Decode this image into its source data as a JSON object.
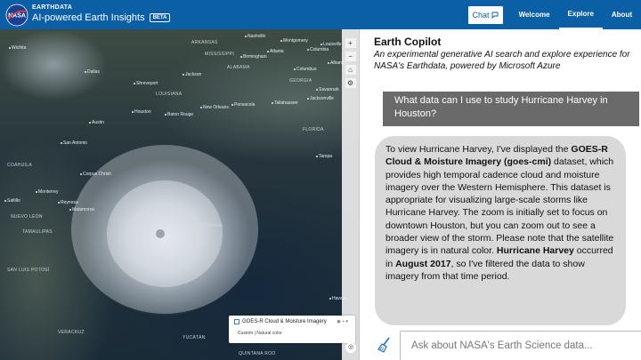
{
  "header": {
    "brand_top": "EARTHDATA",
    "brand_main": "AI-powered Earth Insights",
    "badge": "BETA",
    "logo_icon": "nasa-logo-icon",
    "chat_label": "Chat",
    "nav": [
      {
        "label": "Welcome"
      },
      {
        "label": "Explore"
      },
      {
        "label": "About"
      }
    ]
  },
  "map": {
    "cities": [
      "Louisville",
      "Wichita",
      "Montgomery",
      "Albany",
      "Nashville",
      "Birmingham",
      "Atlanta",
      "Columbus",
      "Columbia",
      "Jackson",
      "Tallahassee",
      "Savannah",
      "Dallas",
      "Shreveport",
      "Baton Rouge",
      "Jacksonville",
      "Austin",
      "New Orleans",
      "Tampa",
      "Houston",
      "San Antonio",
      "Pensacola",
      "Monterrey",
      "Corpus Christi",
      "Saltillo",
      "Reynosa",
      "Matamoros",
      "Havana"
    ],
    "regions": [
      "ARKANSAS",
      "MISSISSIPPI",
      "ALABAMA",
      "GEORGIA",
      "LOUISIANA",
      "FLORIDA",
      "COAHUILA",
      "NUEVO LEÓN",
      "TAMAULIPAS",
      "SAN LUIS POTOSÍ",
      "VERACRUZ",
      "YUCATÁN",
      "QUINTANA ROO"
    ],
    "gulf_label": "Gulf of Mexico",
    "layer": {
      "title": "GOES-R Cloud & Moisture Imagery",
      "subtitle": "Custom | Natural color"
    },
    "tools": [
      "+",
      "−",
      "⌂",
      "⚙"
    ]
  },
  "panel": {
    "title": "Earth Copilot",
    "description": "An experimental generative AI search and explore experience for NASA's Earthdata, powered by Microsoft Azure",
    "user_message": "What data can I use to study Hurricane Harvey in Houston?",
    "bot": {
      "p1": "To view Hurricane Harvey, I've displayed the ",
      "b1": "GOES-R Cloud & Moisture Imagery (goes-cmi)",
      "p2": " dataset, which provides high temporal cadence cloud and moisture imagery over the Western Hemisphere. This dataset is appropriate for visualizing large-scale storms like Hurricane Harvey. The zoom is initially set to focus on downtown Houston, but you can zoom out to see a broader view of the storm. Please note that the satellite imagery is in natural color.  ",
      "b2": "Hurricane Harvey",
      "p3": " occurred in ",
      "b3": "August 2017",
      "p4": ", so I've filtered the data to show imagery from that time period."
    },
    "input_placeholder": "Ask about NASA's Earth Science data..."
  }
}
